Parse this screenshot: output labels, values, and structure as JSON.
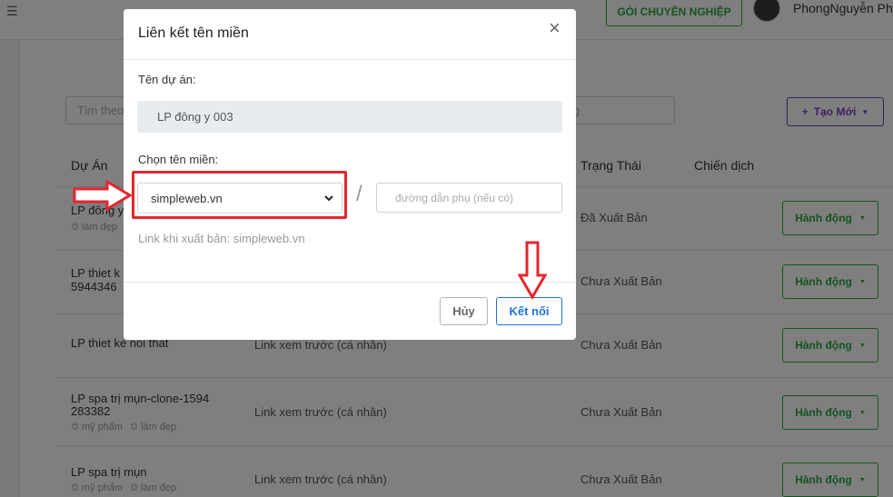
{
  "header": {
    "pro_button": "GÓI CHUYÊN NGHIỆP",
    "user_name": "PhongNguyễn Ph"
  },
  "toolbar": {
    "search_placeholder": "Tìm theo",
    "filter_placeholder": "g",
    "create_label": "Tạo Mới"
  },
  "table": {
    "columns": [
      "Dự Án",
      "Trạng Thái",
      "Chiến dịch"
    ],
    "rows": [
      {
        "name_lines": [
          "LP đông y"
        ],
        "tags": [
          "làm đẹp"
        ],
        "link": "",
        "status": "Đã Xuất Bản",
        "action": "Hành động"
      },
      {
        "name_lines": [
          "LP thiet k",
          "5944346"
        ],
        "tags": [],
        "link": "",
        "status": "Chưa Xuất Bản",
        "action": "Hành động"
      },
      {
        "name_lines": [
          "LP thiet ke noi that"
        ],
        "tags": [],
        "link": "Link xem trước (cá nhân)",
        "status": "Chưa Xuất Bản",
        "action": "Hành động"
      },
      {
        "name_lines": [
          "LP spa trị mụn-clone-1594",
          "283382"
        ],
        "tags": [
          "mỹ phẩm",
          "làm đẹp"
        ],
        "link": "Link xem trước (cá nhân)",
        "status": "Chưa Xuất Bản",
        "action": "Hành động"
      },
      {
        "name_lines": [
          "LP spa trị mụn"
        ],
        "tags": [
          "mỹ phẩm",
          "làm đẹp"
        ],
        "link": "Link xem trước (cá nhân)",
        "status": "Chưa Xuất Bản",
        "action": "Hành động"
      }
    ]
  },
  "modal": {
    "title": "Liên kết tên miền",
    "project_label": "Tên dự án:",
    "project_value": "LP đông y 003",
    "domain_label": "Chọn tên miền:",
    "domain_value": "simpleweb.vn",
    "separator": "/",
    "subpath_placeholder": "đường dẫn phụ (nếu có)",
    "publish_link": "Link khi xuất bản: simpleweb.vn",
    "cancel_label": "Hủy",
    "connect_label": "Kết nối"
  },
  "colors": {
    "green": "#28a745",
    "purple": "#6f42c1",
    "blue": "#1e73d6",
    "annotation_red": "#e4262d"
  }
}
